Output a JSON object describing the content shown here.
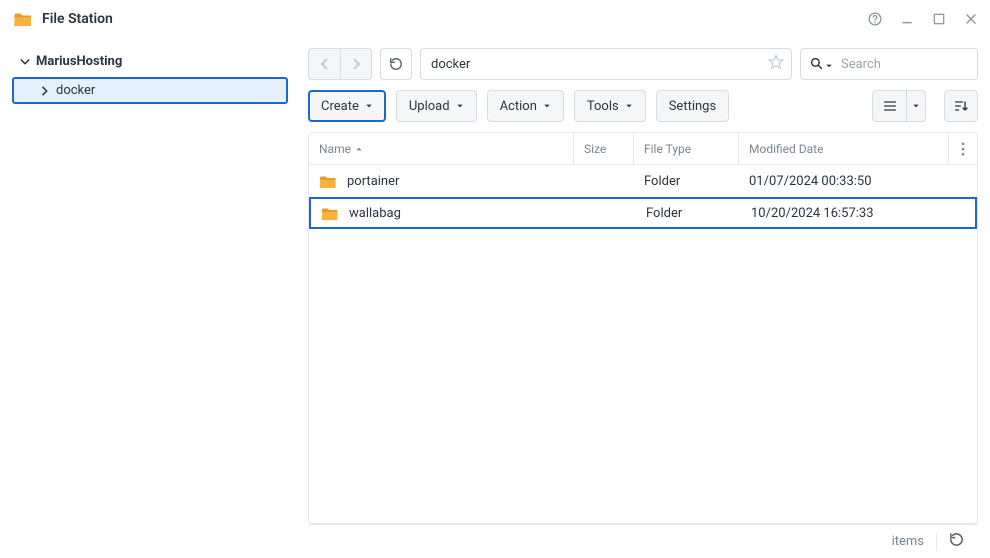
{
  "app": {
    "title": "File Station"
  },
  "sidebar": {
    "root": "MariusHosting",
    "items": [
      {
        "label": "docker",
        "selected": true
      }
    ]
  },
  "pathbar": {
    "value": "docker"
  },
  "search": {
    "placeholder": "Search"
  },
  "toolbar": {
    "create": "Create",
    "upload": "Upload",
    "action": "Action",
    "tools": "Tools",
    "settings": "Settings"
  },
  "table": {
    "columns": {
      "name": "Name",
      "size": "Size",
      "type": "File Type",
      "date": "Modified Date"
    },
    "rows": [
      {
        "name": "portainer",
        "size": "",
        "type": "Folder",
        "date": "01/07/2024 00:33:50",
        "highlighted": false
      },
      {
        "name": "wallabag",
        "size": "",
        "type": "Folder",
        "date": "10/20/2024 16:57:33",
        "highlighted": true
      }
    ]
  },
  "status": {
    "items_label": "items"
  }
}
